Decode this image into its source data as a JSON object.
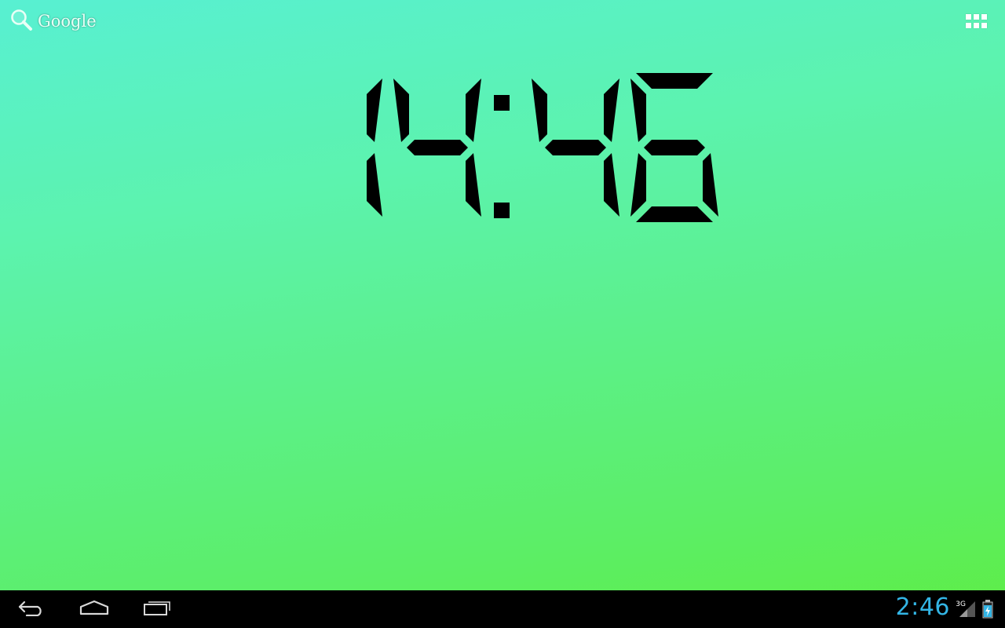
{
  "search": {
    "label": "Google",
    "icon": "magnifier-icon"
  },
  "launcher": {
    "apps_icon": "all-apps-grid-icon"
  },
  "clock_widget": {
    "time": "14:46",
    "digit_color": "#000000"
  },
  "navigation": {
    "back_icon": "back-arrow-icon",
    "home_icon": "home-icon",
    "recents_icon": "recent-apps-icon"
  },
  "status_bar": {
    "time": "2:46",
    "network": "3G",
    "time_color": "#33b5e5"
  }
}
